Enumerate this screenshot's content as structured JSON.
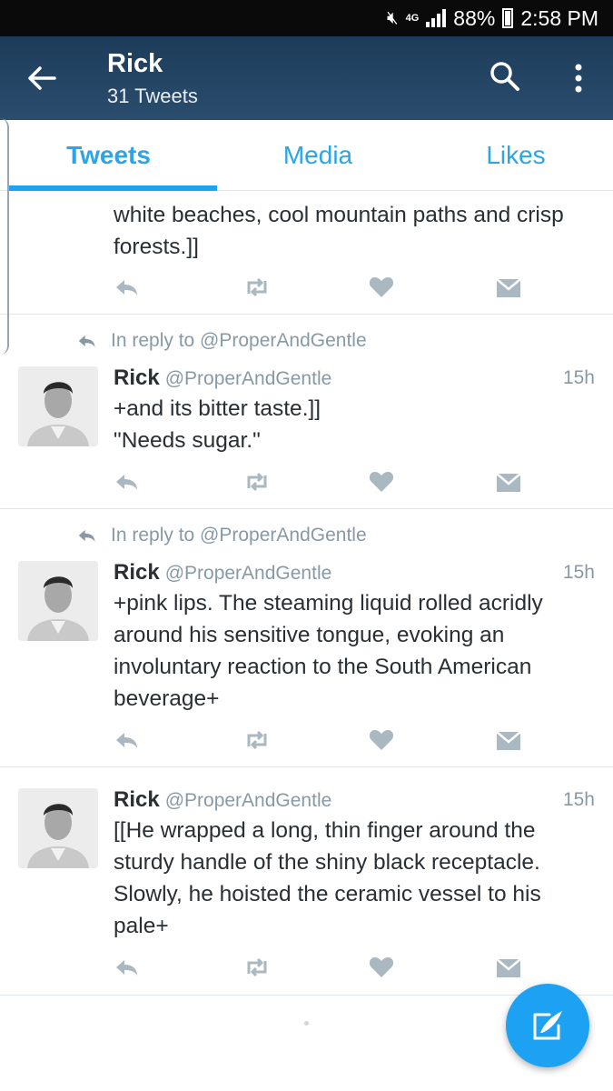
{
  "status_bar": {
    "network": "4G",
    "battery": "88%",
    "time": "2:58 PM"
  },
  "header": {
    "title": "Rick",
    "subtitle": "31 Tweets"
  },
  "tabs": [
    {
      "label": "Tweets",
      "active": true
    },
    {
      "label": "Media",
      "active": false
    },
    {
      "label": "Likes",
      "active": false
    }
  ],
  "tweets": [
    {
      "partial": true,
      "text": "white beaches, cool mountain paths and crisp\nforests.]]"
    },
    {
      "reply_context": "In reply to @ProperAndGentle",
      "name": "Rick",
      "handle": "@ProperAndGentle",
      "time": "15h",
      "text": "+and its bitter taste.]]\n\"Needs sugar.\""
    },
    {
      "reply_context": "In reply to @ProperAndGentle",
      "name": "Rick",
      "handle": "@ProperAndGentle",
      "time": "15h",
      "text": "+pink lips. The steaming liquid rolled acridly\naround his sensitive tongue, evoking an\ninvoluntary reaction to the South American\nbeverage+"
    },
    {
      "name": "Rick",
      "handle": "@ProperAndGentle",
      "time": "15h",
      "text": "[[He wrapped a long, thin finger around the\nsturdy handle of the shiny black receptacle.\nSlowly, he hoisted the ceramic vessel to his\npale+"
    }
  ],
  "colors": {
    "header": "#2b4d6e",
    "accent": "#1da1f2",
    "muted": "#8899a6",
    "action_icon": "#aab8c2"
  },
  "icons": [
    "back-arrow-icon",
    "search-icon",
    "more-vert-icon",
    "reply-icon",
    "retweet-icon",
    "like-icon",
    "direct-message-icon",
    "compose-tweet-icon"
  ]
}
